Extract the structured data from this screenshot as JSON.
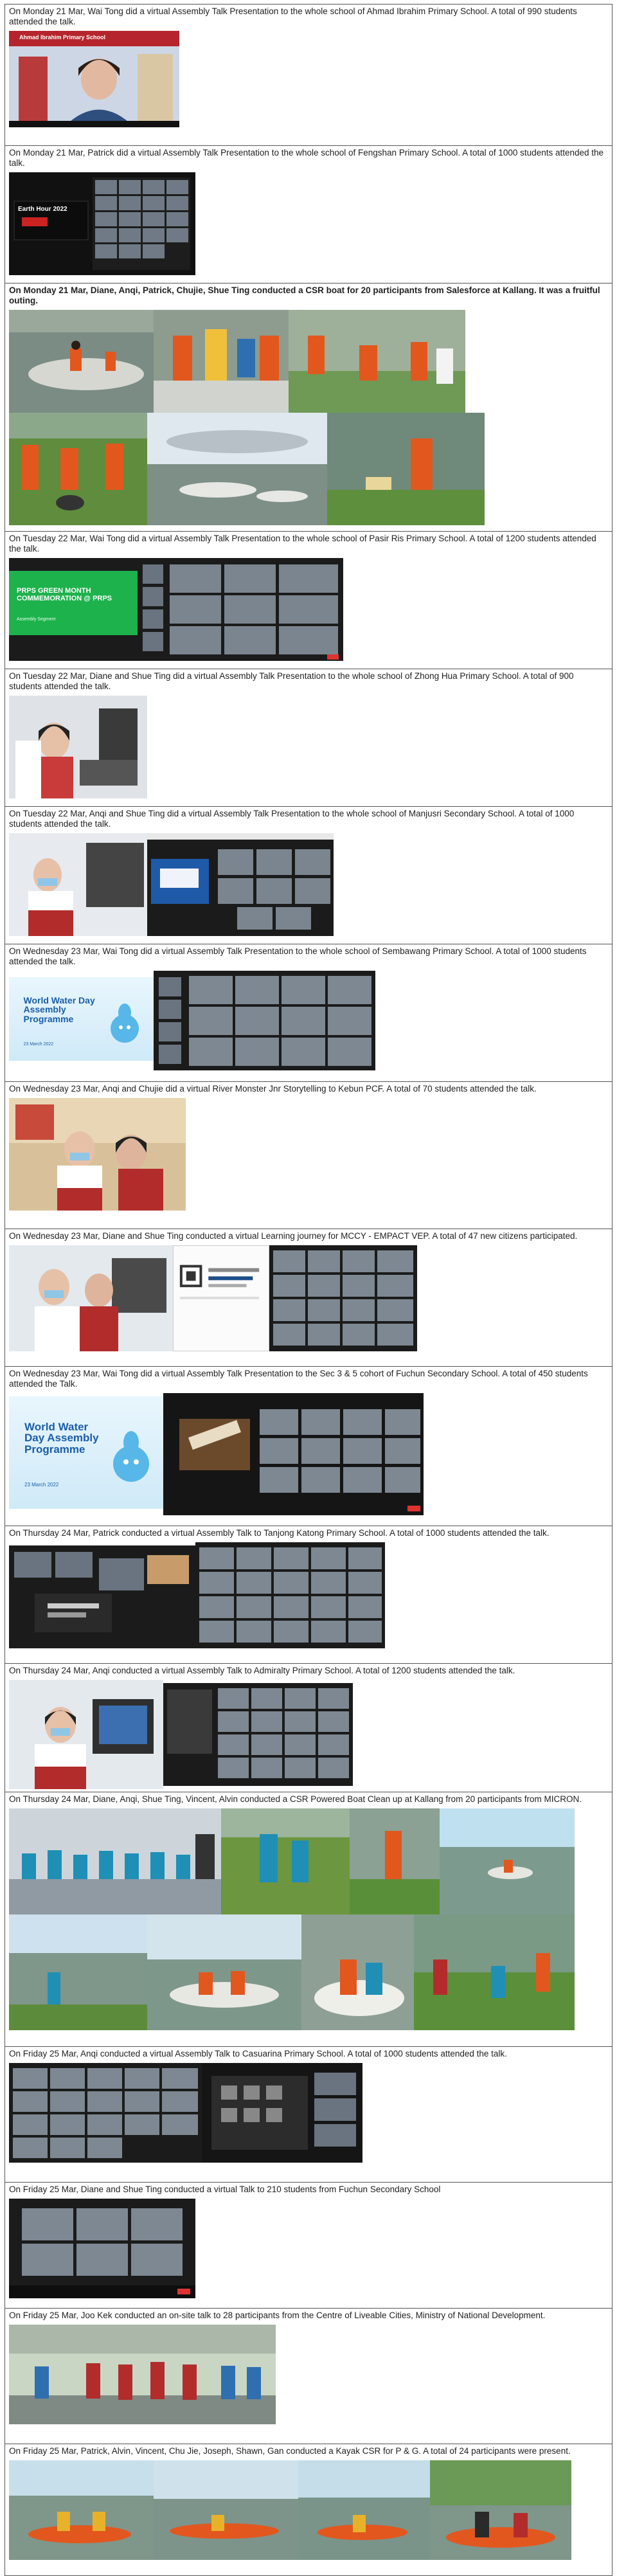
{
  "entries": [
    {
      "caption": "On Monday 21 Mar, Wai Tong did a virtual Assembly Talk Presentation to the whole school of Ahmad Ibrahim Primary School. A total of 990 students attended the talk.",
      "bold": false,
      "slide_text": "Ahmad Ibrahim Primary School"
    },
    {
      "caption": "On Monday 21 Mar, Patrick did a virtual Assembly Talk Presentation to the whole school of Fengshan Primary School. A total of 1000 students attended the talk.",
      "bold": false,
      "slide_text": "Earth Hour 2022"
    },
    {
      "caption": "On Monday 21 Mar, Diane, Anqi, Patrick, Chujie, Shue Ting conducted a CSR boat for 20 participants from Salesforce at Kallang. It was a fruitful outing.",
      "bold": true
    },
    {
      "caption": "On Tuesday 22 Mar, Wai Tong did a virtual Assembly Talk Presentation to the whole school of Pasir Ris Primary School. A total of 1200 students attended the talk.",
      "bold": false,
      "slide_text": "PRPS GREEN MONTH COMMEMORATION @ PRPS",
      "slide_sub": "Assembly Segment"
    },
    {
      "caption": "On Tuesday 22 Mar, Diane and Shue Ting did a virtual Assembly Talk Presentation to the whole school of Zhong Hua Primary School. A total of 900 students attended the talk.",
      "bold": false
    },
    {
      "caption": "On Tuesday 22 Mar, Anqi and Shue Ting did a virtual Assembly Talk Presentation to the whole school of Manjusri Secondary School. A total of 1000 students attended the talk.",
      "bold": false
    },
    {
      "caption": "On Wednesday 23 Mar, Wai Tong did a virtual Assembly Talk Presentation to the whole school of Sembawang Primary School. A total of 1000 students attended the talk.",
      "bold": false,
      "slide_text": "World Water Day Assembly Programme",
      "slide_date": "23 March 2022"
    },
    {
      "caption": "On Wednesday 23 Mar, Anqi and Chujie did a virtual River Monster Jnr Storytelling to Kebun PCF. A total of 70 students attended the talk.",
      "bold": false
    },
    {
      "caption": "On Wednesday 23 Mar, Diane and Shue Ting conducted a virtual Learning journey for MCCY - EMPACT VEP. A total of 47 new citizens participated.",
      "bold": false
    },
    {
      "caption": "On Wednesday 23 Mar, Wai Tong did a virtual Assembly Talk Presentation to the Sec 3 & 5 cohort of Fuchun Secondary School. A total of 450 students attended the Talk.",
      "bold": false,
      "slide_text": "World Water Day Assembly Programme",
      "slide_date": "23 March 2022"
    },
    {
      "caption": "On Thursday 24 Mar, Patrick conducted a virtual Assembly Talk to Tanjong Katong Primary School. A total of 1000 students attended the talk.",
      "bold": false
    },
    {
      "caption": "On Thursday 24 Mar, Anqi conducted a virtual Assembly Talk to Admiralty Primary School. A total of 1200 students attended the talk.",
      "bold": false
    },
    {
      "caption": "On Thursday 24 Mar, Diane, Anqi, Shue Ting, Vincent, Alvin conducted a CSR Powered Boat Clean up at Kallang from 20 participants from MICRON.",
      "bold": false
    },
    {
      "caption": "On Friday 25 Mar, Anqi conducted a virtual Assembly Talk to Casuarina Primary School. A total of 1000 students attended the talk.",
      "bold": false
    },
    {
      "caption": "On Friday 25 Mar, Diane and Shue Ting conducted a virtual Talk to 210 students from Fuchun Secondary School",
      "bold": false
    },
    {
      "caption": "On Friday 25 Mar, Joo Kek conducted an on-site talk to 28 participants from the Centre of Liveable Cities, Ministry of National Development.",
      "bold": false
    },
    {
      "caption": "On Friday 25 Mar, Patrick, Alvin, Vincent, Chu Jie, Joseph, Shawn, Gan conducted a Kayak CSR for P & G. A total of 24 participants were present.",
      "bold": false
    }
  ],
  "colors": {
    "border": "#555555",
    "text": "#1f1f1f",
    "zoom_bg": "#1b1b1b",
    "grass": "#5a9a3a",
    "water": "#7e8f86",
    "lifejacket": "#e2571e",
    "slide_green": "#1eb24d",
    "wwd_blue": "#1b5ea7"
  }
}
